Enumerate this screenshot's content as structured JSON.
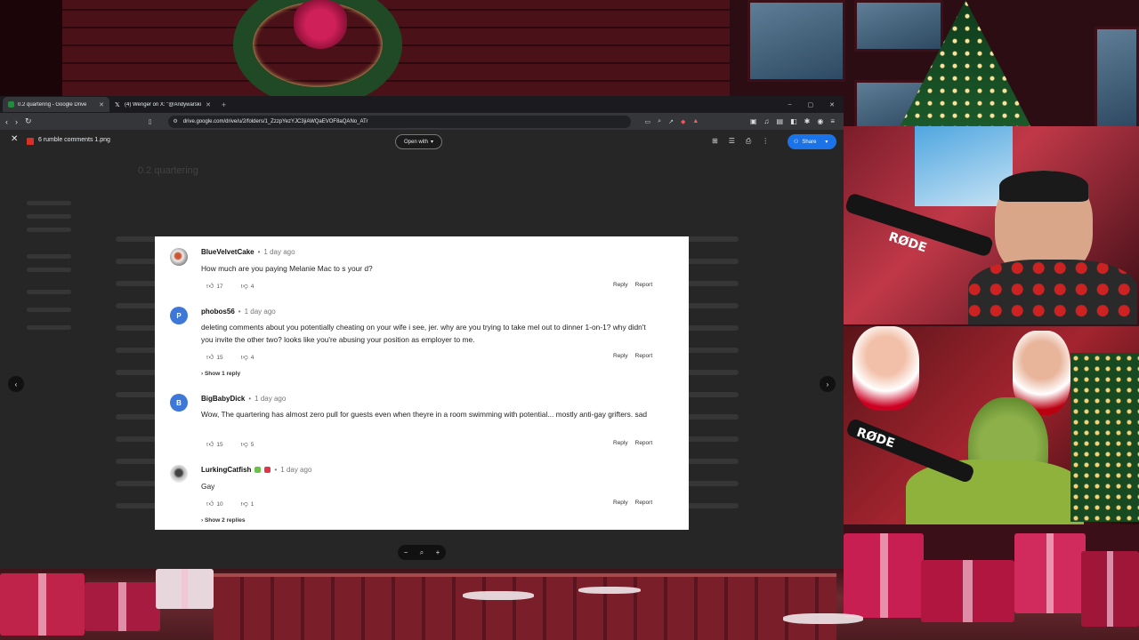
{
  "browser": {
    "tabs": [
      {
        "title": "0.2 quartering - Google Drive",
        "active": true,
        "favicon_color": "#1e8e3e"
      },
      {
        "title": "(4) Wenger on X: \"@Andywarski http",
        "active": false,
        "favicon_color": "#ffffff"
      }
    ],
    "new_tab": "+",
    "url": "drive.google.com/drive/u/2/folders/1_ZzzpYezYJC3jiAWQaEVOF8aQANo_ATr"
  },
  "viewer": {
    "file_name": "6 rumble comments 1.png",
    "open_with": "Open with",
    "share": "Share",
    "accent": "#1a73e8",
    "background_folder_title": "0.2 quartering"
  },
  "comments": [
    {
      "user": "BlueVelvetCake",
      "ago": "1 day ago",
      "avatar": {
        "type": "image",
        "letter": ""
      },
      "text": "How much are you paying Melanie Mac to s your d?",
      "likes": "17",
      "dislikes": "4",
      "reply": "Reply",
      "report": "Report",
      "replies_link": ""
    },
    {
      "user": "phobos56",
      "ago": "1 day ago",
      "avatar": {
        "type": "letter",
        "letter": "P",
        "color": "#3d78d8"
      },
      "text": "deleting comments about you potentially cheating on your wife i see, jer. why are you trying to take mel out to dinner 1-on-1? why didn't you invite the other two? looks like you're abusing your position as employer to me.",
      "likes": "15",
      "dislikes": "4",
      "reply": "Reply",
      "report": "Report",
      "replies_link": "› Show 1 reply"
    },
    {
      "user": "BigBabyDick",
      "ago": "1 day ago",
      "avatar": {
        "type": "letter",
        "letter": "B",
        "color": "#3d78d8"
      },
      "text": "Wow, The quartering has almost zero pull for guests even when theyre in a room swimming with potential... mostly anti-gay grifters. sad",
      "likes": "15",
      "dislikes": "5",
      "reply": "Reply",
      "report": "Report",
      "replies_link": ""
    },
    {
      "user": "LurkingCatfish",
      "ago": "1 day ago",
      "avatar": {
        "type": "image",
        "letter": ""
      },
      "text": "Gay",
      "likes": "10",
      "dislikes": "1",
      "reply": "Reply",
      "report": "Report",
      "replies_link": "› Show 2 replies"
    }
  ],
  "overlay": {
    "mic_brand": "RØDE"
  }
}
